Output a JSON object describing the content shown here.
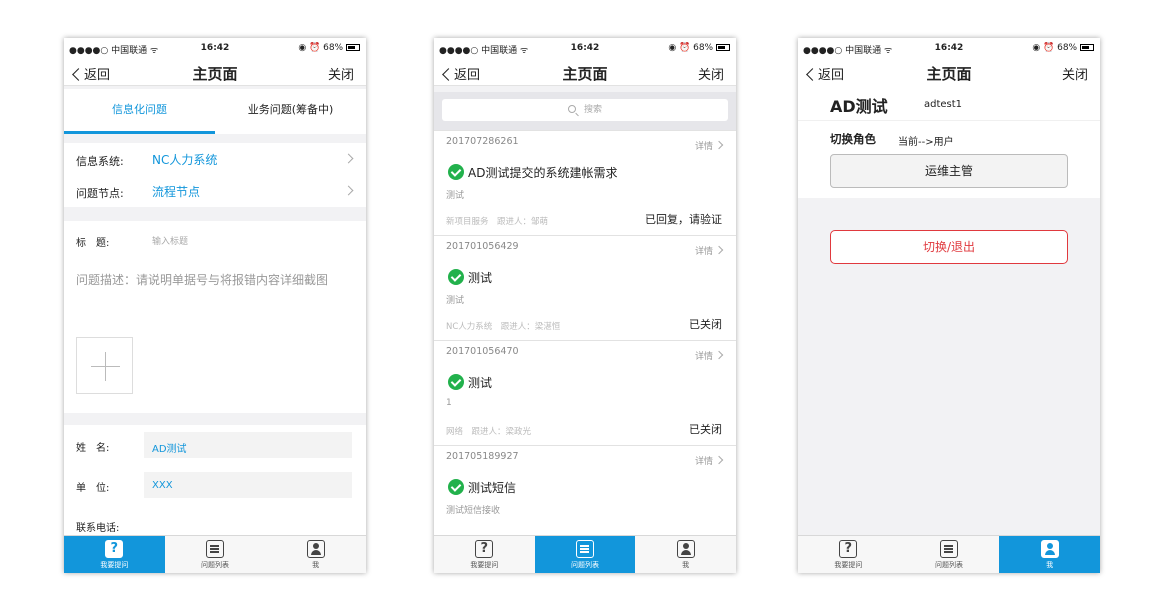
{
  "status_bar": {
    "carrier": "●●●●○ 中国联通 ᯤ",
    "time": "16:42",
    "battery": "◉ ⏰ 68%"
  },
  "nav": {
    "back": "返回",
    "title": "主页面",
    "close": "关闭"
  },
  "tabbar": {
    "ask": "我要提问",
    "list": "问题列表",
    "me": "我"
  },
  "form_screen": {
    "tabs": [
      "信息化问题",
      "业务问题(筹备中)"
    ],
    "system_label": "信息系统:",
    "system_value": "NC人力系统",
    "node_label": "问题节点:",
    "node_value": "流程节点",
    "title_label": "标　题:",
    "title_placeholder": "输入标题",
    "desc_placeholder": "问题描述：请说明单据号与将报错内容详细截图",
    "name_label": "姓　名:",
    "name_value": "AD测试",
    "unit_label": "单　位:",
    "unit_value": "XXX",
    "phone_label": "联系电话:"
  },
  "list_screen": {
    "search_placeholder": "搜索",
    "detail_label": "详情",
    "items": [
      {
        "no": "201707286261",
        "title": "AD测试提交的系统建帐需求",
        "sub": "测试",
        "meta": "新项目服务　跟进人：邹萌",
        "status": "已回复，请验证"
      },
      {
        "no": "201701056429",
        "title": "测试",
        "sub": "测试",
        "meta": "NC人力系统　跟进人：梁湛恒",
        "status": "已关闭"
      },
      {
        "no": "201701056470",
        "title": "测试",
        "sub": "1",
        "meta": "网络　跟进人：梁政光",
        "status": "已关闭"
      },
      {
        "no": "201705189927",
        "title": "测试短信",
        "sub": "测试短信接收",
        "meta": "",
        "status": ""
      }
    ]
  },
  "me_screen": {
    "name": "AD测试",
    "account": "adtest1",
    "role_label": "切换角色",
    "current": "当前-->用户",
    "role_button": "运维主管",
    "switch_button": "切换/退出"
  },
  "colors": {
    "accent": "#1296db",
    "success": "#22b14c",
    "danger": "#e0393e"
  }
}
